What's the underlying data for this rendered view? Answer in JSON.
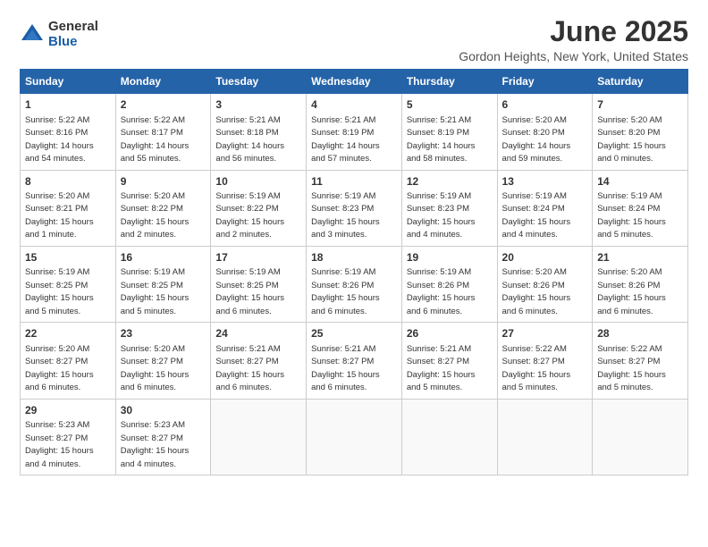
{
  "logo": {
    "general": "General",
    "blue": "Blue"
  },
  "title": "June 2025",
  "location": "Gordon Heights, New York, United States",
  "headers": [
    "Sunday",
    "Monday",
    "Tuesday",
    "Wednesday",
    "Thursday",
    "Friday",
    "Saturday"
  ],
  "weeks": [
    [
      {
        "day": "1",
        "info": "Sunrise: 5:22 AM\nSunset: 8:16 PM\nDaylight: 14 hours\nand 54 minutes."
      },
      {
        "day": "2",
        "info": "Sunrise: 5:22 AM\nSunset: 8:17 PM\nDaylight: 14 hours\nand 55 minutes."
      },
      {
        "day": "3",
        "info": "Sunrise: 5:21 AM\nSunset: 8:18 PM\nDaylight: 14 hours\nand 56 minutes."
      },
      {
        "day": "4",
        "info": "Sunrise: 5:21 AM\nSunset: 8:19 PM\nDaylight: 14 hours\nand 57 minutes."
      },
      {
        "day": "5",
        "info": "Sunrise: 5:21 AM\nSunset: 8:19 PM\nDaylight: 14 hours\nand 58 minutes."
      },
      {
        "day": "6",
        "info": "Sunrise: 5:20 AM\nSunset: 8:20 PM\nDaylight: 14 hours\nand 59 minutes."
      },
      {
        "day": "7",
        "info": "Sunrise: 5:20 AM\nSunset: 8:20 PM\nDaylight: 15 hours\nand 0 minutes."
      }
    ],
    [
      {
        "day": "8",
        "info": "Sunrise: 5:20 AM\nSunset: 8:21 PM\nDaylight: 15 hours\nand 1 minute."
      },
      {
        "day": "9",
        "info": "Sunrise: 5:20 AM\nSunset: 8:22 PM\nDaylight: 15 hours\nand 2 minutes."
      },
      {
        "day": "10",
        "info": "Sunrise: 5:19 AM\nSunset: 8:22 PM\nDaylight: 15 hours\nand 2 minutes."
      },
      {
        "day": "11",
        "info": "Sunrise: 5:19 AM\nSunset: 8:23 PM\nDaylight: 15 hours\nand 3 minutes."
      },
      {
        "day": "12",
        "info": "Sunrise: 5:19 AM\nSunset: 8:23 PM\nDaylight: 15 hours\nand 4 minutes."
      },
      {
        "day": "13",
        "info": "Sunrise: 5:19 AM\nSunset: 8:24 PM\nDaylight: 15 hours\nand 4 minutes."
      },
      {
        "day": "14",
        "info": "Sunrise: 5:19 AM\nSunset: 8:24 PM\nDaylight: 15 hours\nand 5 minutes."
      }
    ],
    [
      {
        "day": "15",
        "info": "Sunrise: 5:19 AM\nSunset: 8:25 PM\nDaylight: 15 hours\nand 5 minutes."
      },
      {
        "day": "16",
        "info": "Sunrise: 5:19 AM\nSunset: 8:25 PM\nDaylight: 15 hours\nand 5 minutes."
      },
      {
        "day": "17",
        "info": "Sunrise: 5:19 AM\nSunset: 8:25 PM\nDaylight: 15 hours\nand 6 minutes."
      },
      {
        "day": "18",
        "info": "Sunrise: 5:19 AM\nSunset: 8:26 PM\nDaylight: 15 hours\nand 6 minutes."
      },
      {
        "day": "19",
        "info": "Sunrise: 5:19 AM\nSunset: 8:26 PM\nDaylight: 15 hours\nand 6 minutes."
      },
      {
        "day": "20",
        "info": "Sunrise: 5:20 AM\nSunset: 8:26 PM\nDaylight: 15 hours\nand 6 minutes."
      },
      {
        "day": "21",
        "info": "Sunrise: 5:20 AM\nSunset: 8:26 PM\nDaylight: 15 hours\nand 6 minutes."
      }
    ],
    [
      {
        "day": "22",
        "info": "Sunrise: 5:20 AM\nSunset: 8:27 PM\nDaylight: 15 hours\nand 6 minutes."
      },
      {
        "day": "23",
        "info": "Sunrise: 5:20 AM\nSunset: 8:27 PM\nDaylight: 15 hours\nand 6 minutes."
      },
      {
        "day": "24",
        "info": "Sunrise: 5:21 AM\nSunset: 8:27 PM\nDaylight: 15 hours\nand 6 minutes."
      },
      {
        "day": "25",
        "info": "Sunrise: 5:21 AM\nSunset: 8:27 PM\nDaylight: 15 hours\nand 6 minutes."
      },
      {
        "day": "26",
        "info": "Sunrise: 5:21 AM\nSunset: 8:27 PM\nDaylight: 15 hours\nand 5 minutes."
      },
      {
        "day": "27",
        "info": "Sunrise: 5:22 AM\nSunset: 8:27 PM\nDaylight: 15 hours\nand 5 minutes."
      },
      {
        "day": "28",
        "info": "Sunrise: 5:22 AM\nSunset: 8:27 PM\nDaylight: 15 hours\nand 5 minutes."
      }
    ],
    [
      {
        "day": "29",
        "info": "Sunrise: 5:23 AM\nSunset: 8:27 PM\nDaylight: 15 hours\nand 4 minutes."
      },
      {
        "day": "30",
        "info": "Sunrise: 5:23 AM\nSunset: 8:27 PM\nDaylight: 15 hours\nand 4 minutes."
      },
      null,
      null,
      null,
      null,
      null
    ]
  ]
}
